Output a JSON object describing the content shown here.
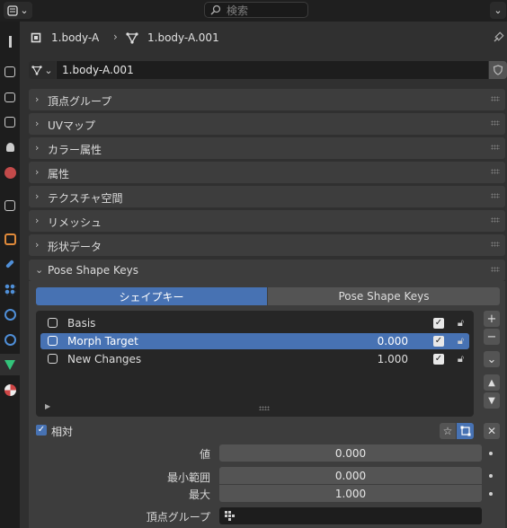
{
  "topbar": {
    "search_placeholder": "検索"
  },
  "breadcrumb": {
    "object": "1.body-A",
    "mesh": "1.body-A.001"
  },
  "datablock": {
    "name": "1.body-A.001"
  },
  "panels": [
    {
      "title": "頂点グループ"
    },
    {
      "title": "UVマップ"
    },
    {
      "title": "カラー属性"
    },
    {
      "title": "属性"
    },
    {
      "title": "テクスチャ空間"
    },
    {
      "title": "リメッシュ"
    },
    {
      "title": "形状データ"
    }
  ],
  "pose_panel": {
    "title": "Pose Shape Keys",
    "tabs": [
      "シェイプキー",
      "Pose Shape Keys"
    ],
    "keys": [
      {
        "name": "Basis",
        "value": ""
      },
      {
        "name": "Morph Target",
        "value": "0.000"
      },
      {
        "name": "New Changes",
        "value": "1.000"
      }
    ],
    "relative_label": "相対",
    "props": {
      "value_label": "値",
      "value": "0.000",
      "min_label": "最小範囲",
      "min": "0.000",
      "max_label": "最大",
      "max": "1.000",
      "vgroup_label": "頂点グループ"
    }
  },
  "colors": {
    "accent": "#4772b3",
    "panel": "#3d3d3d",
    "background": "#303030"
  }
}
